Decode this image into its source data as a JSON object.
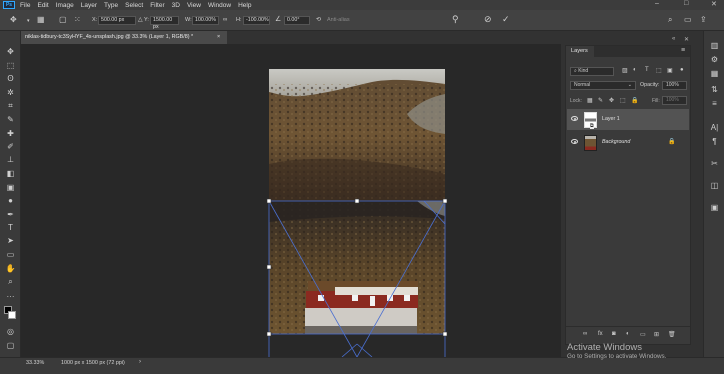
{
  "app": {
    "logo": "Ps"
  },
  "menu": [
    "File",
    "Edit",
    "Image",
    "Layer",
    "Type",
    "Select",
    "Filter",
    "3D",
    "View",
    "Window",
    "Help"
  ],
  "options": {
    "x_label": "X:",
    "x_value": "500.00 px",
    "y_label": "Y:",
    "y_value": "1500.00 px",
    "w_label": "W:",
    "w_value": "100.00%",
    "h_label": "H:",
    "h_value": "-100.00%",
    "angle_value": "0.00",
    "angle_unit": "°",
    "h_skew": "H:",
    "v_skew": "V:",
    "antialias": "Anti-alias"
  },
  "document": {
    "tab": "niklas-tidbury-tc3SyHYF_4s-unsplash.jpg @ 33.3% (Layer 1, RGB/8) *",
    "close": "×"
  },
  "layers_panel": {
    "title": "Layers",
    "kind": "Kind",
    "blend_mode": "Normal",
    "opacity_label": "Opacity:",
    "opacity_value": "100%",
    "lock_label": "Lock:",
    "fill_label": "Fill:",
    "fill_value": "100%",
    "layers": [
      {
        "name": "Layer 1",
        "selected": true
      },
      {
        "name": "Background",
        "selected": false,
        "locked": true
      }
    ]
  },
  "status": {
    "zoom": "33.33%",
    "doc_info": "1000 px x 1500 px (72 ppi)",
    "arrow": "›"
  },
  "watermark": {
    "title": "Activate Windows",
    "subtitle": "Go to Settings to activate Windows."
  },
  "colors": {
    "accent": "#31a8ff",
    "panel": "#3a3a3a",
    "canvas": "#282828",
    "barn_red": "#8b2a20"
  }
}
